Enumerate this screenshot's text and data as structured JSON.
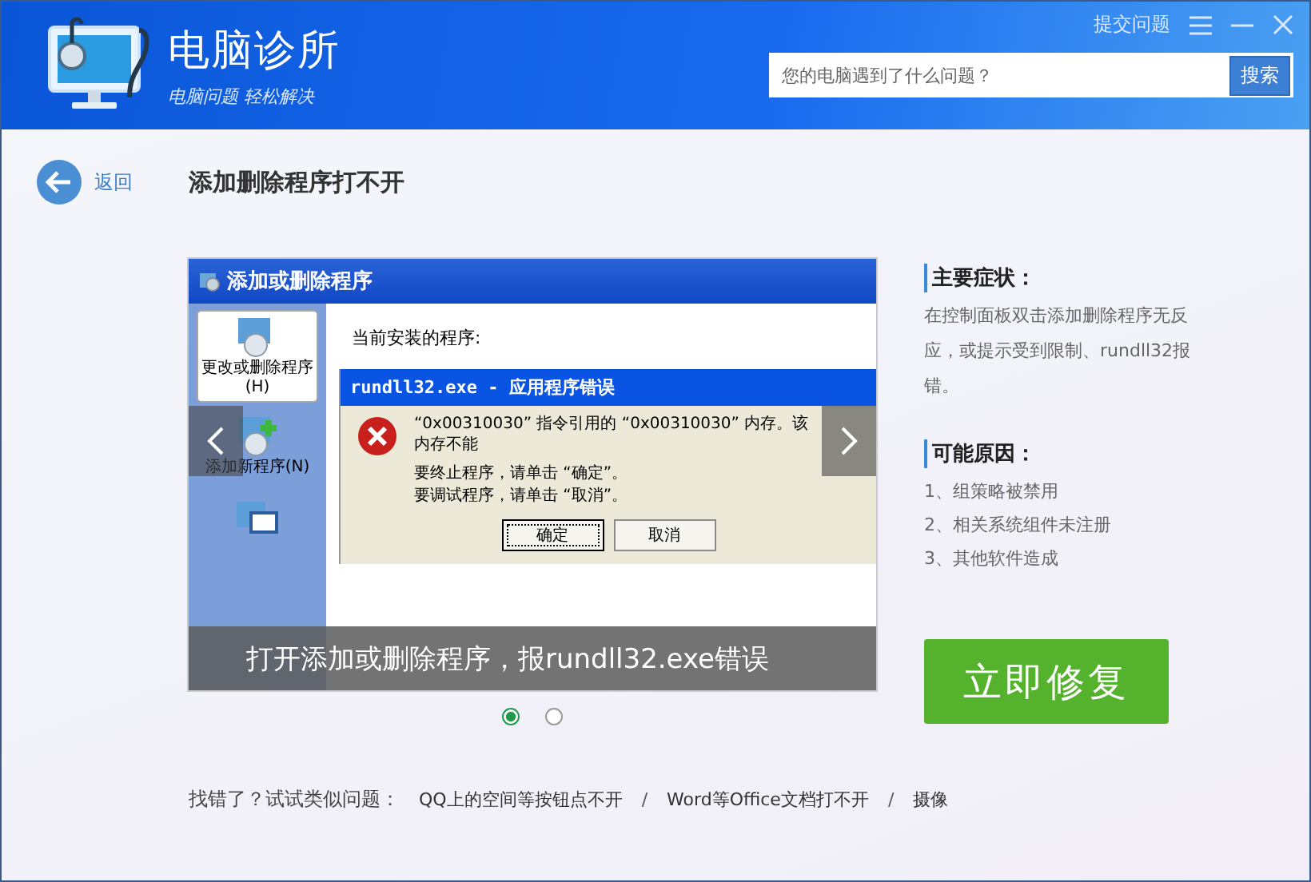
{
  "header": {
    "app_name": "电脑诊所",
    "slogan": "电脑问题 轻松解决",
    "submit_link": "提交问题",
    "search": {
      "placeholder": "您的电脑遇到了什么问题？",
      "button": "搜索"
    }
  },
  "nav": {
    "back": "返回",
    "title": "添加删除程序打不开"
  },
  "carousel": {
    "slide": {
      "window_title": "添加或删除程序",
      "sidebar": [
        {
          "label": "更改或删除程序(H)",
          "selected": true
        },
        {
          "label": "添加新程序(N)",
          "selected": false
        }
      ],
      "list_heading": "当前安装的程序:",
      "error": {
        "title": "rundll32.exe - 应用程序错误",
        "message": "“0x00310030” 指令引用的 “0x00310030” 内存。该内存不能",
        "lines": [
          "要终止程序，请单击 “确定”。",
          "要调试程序，请单击 “取消”。"
        ],
        "buttons": [
          {
            "label": "确定",
            "focused": true
          },
          {
            "label": "取消",
            "focused": false
          }
        ]
      }
    },
    "caption": "打开添加或删除程序，报rundll32.exe错误",
    "dots": [
      {
        "selected": true
      },
      {
        "selected": false
      }
    ]
  },
  "symptoms": {
    "heading": "主要症状：",
    "text": "在控制面板双击添加删除程序无反应，或提示受到限制、rundll32报错。"
  },
  "causes": {
    "heading": "可能原因：",
    "items": [
      "1、组策略被禁用",
      "2、相关系统组件未注册",
      "3、其他软件造成"
    ]
  },
  "fix_button": "立即修复",
  "related": {
    "label": "找错了？试试类似问题：",
    "separator": "/",
    "links": [
      "QQ上的空间等按钮点不开",
      "Word等Office文档打不开",
      "摄像"
    ]
  }
}
